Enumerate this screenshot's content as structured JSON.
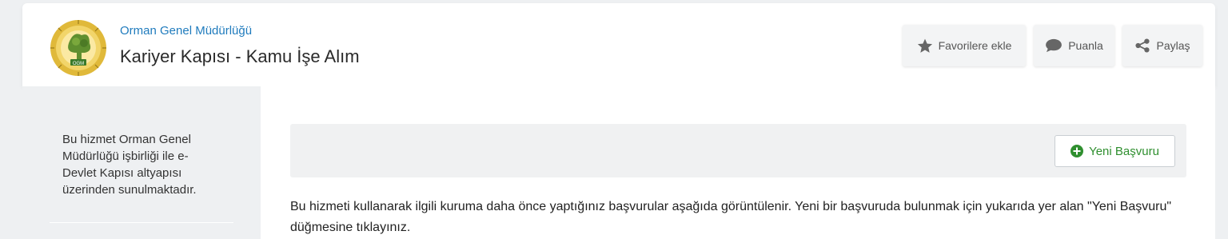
{
  "header": {
    "org_name": "Orman Genel Müdürlüğü",
    "service_title": "Kariyer Kapısı - Kamu İşe Alım",
    "buttons": {
      "favorite": "Favorilere ekle",
      "rate": "Puanla",
      "share": "Paylaş"
    },
    "logo_text": "OGM"
  },
  "sidebar": {
    "text": "Bu hizmet Orman Genel Müdürlüğü işbirliği ile e-Devlet Kapısı altyapısı üzerinden sunulmaktadır."
  },
  "main": {
    "new_application_label": "Yeni Başvuru",
    "description": "Bu hizmeti kullanarak ilgili kuruma daha önce yaptığınız başvurular aşağıda görüntülenir. Yeni bir başvuruda bulunmak için yukarıda yer alan \"Yeni Başvuru\" düğmesine tıklayınız."
  },
  "colors": {
    "accent_link": "#1f7bbd",
    "success_green": "#2f8f2f",
    "icon_gray": "#666666"
  },
  "icons": {
    "favorite": "star-icon",
    "rate": "speech-bubble-icon",
    "share": "share-icon",
    "new_application": "plus-circle-icon"
  }
}
